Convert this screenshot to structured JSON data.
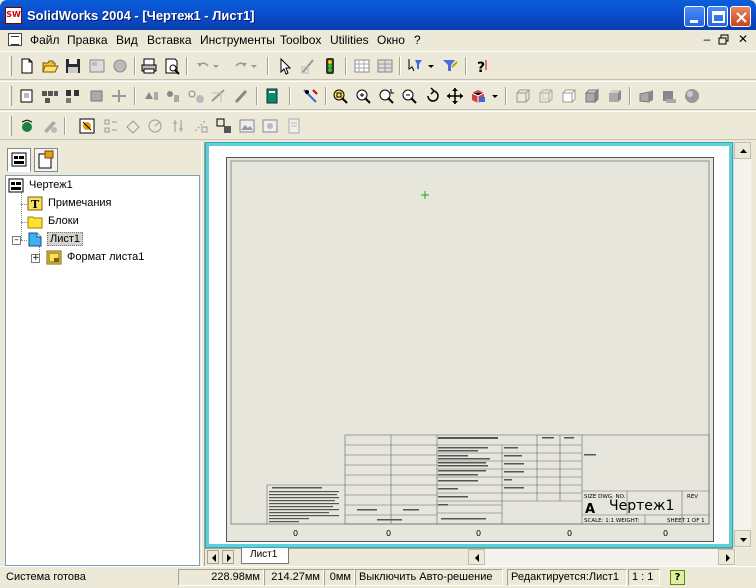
{
  "window": {
    "title": "SolidWorks 2004 - [Чертеж1 - Лист1]"
  },
  "menu": {
    "items": [
      "Файл",
      "Правка",
      "Вид",
      "Вставка",
      "Инструменты",
      "Toolbox",
      "Utilities",
      "Окно",
      "?"
    ]
  },
  "tree": {
    "root": "Чертеж1",
    "annotations": "Примечания",
    "blocks": "Блоки",
    "sheet": "Лист1",
    "sheet_format": "Формат листа1"
  },
  "drawing": {
    "title": "Чертеж1",
    "size_letter": "A",
    "header_labels": {
      "size": "SIZE DWG. NO.",
      "rev": "REV",
      "scale": "SCALE: 1:1   WEIGHT:",
      "sheet": "SHEET 1 OF 1",
      "title": "TITLE:",
      "name": "NAME",
      "date": "DATE",
      "drawn": "DRAWN",
      "checked": "CHECKED",
      "eng_appr": "ENG APPR.",
      "mfg_appr": "MFG APPR.",
      "qa": "Q.A.",
      "comments": "COMMENTS:",
      "tolerance": "DIMENSIONS ARE IN INCHES"
    },
    "zone_markers": [
      "0",
      "0",
      "0",
      "0",
      "0"
    ]
  },
  "sheet_tabs": [
    "Лист1"
  ],
  "status": {
    "message": "Система готова",
    "x": "228.98мм",
    "y": "214.27мм",
    "z": "0мм",
    "mode": "Выключить Авто-решение",
    "editing": "Редактируется:Лист1",
    "scale": "1 : 1"
  },
  "icons": [
    "app-icon",
    "minimize-icon",
    "maximize-icon",
    "close-icon",
    "new-icon",
    "open-icon",
    "save-icon",
    "print-icon",
    "print-preview-icon",
    "undo-icon",
    "redo-icon",
    "select-icon",
    "sketch-icon",
    "traffic-light-icon",
    "grid-icon",
    "help-icon",
    "zoom-fit-icon",
    "zoom-in-icon",
    "zoom-area-icon",
    "zoom-out-icon",
    "rotate-icon",
    "pan-icon"
  ]
}
